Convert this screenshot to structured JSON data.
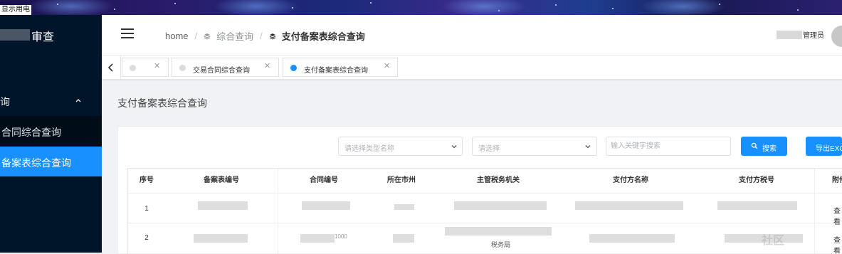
{
  "banner": {
    "label": "显示用电"
  },
  "sidebar": {
    "app_title": "审查",
    "menu_group": "询",
    "items": [
      {
        "label": "合同综合查询",
        "active": false
      },
      {
        "label": "备案表综合查询",
        "active": true
      }
    ],
    "colors": {
      "bg": "#001529",
      "active": "#1890ff"
    }
  },
  "header": {
    "menu_icon": "hamburger-icon",
    "breadcrumb": [
      {
        "label": "home"
      },
      {
        "label": "综合查询",
        "icon": "layers-icon"
      },
      {
        "label": "支付备案表综合查询",
        "icon": "layers-icon"
      }
    ],
    "user_role": "管理员"
  },
  "tabs": [
    {
      "label": "",
      "active": false
    },
    {
      "label": "交易合同综合查询",
      "active": false
    },
    {
      "label": "支付备案表综合查询",
      "active": true
    }
  ],
  "main": {
    "page_title": "支付备案表综合查询",
    "filters": {
      "type_select_placeholder": "请选择类型名称",
      "select2_placeholder": "请选择",
      "keyword_placeholder": "输入关键字搜索"
    },
    "buttons": {
      "search": "搜索",
      "export": "导出EXC"
    },
    "table": {
      "columns": [
        "序号",
        "备案表编号",
        "合同编号",
        "所在市州",
        "主管税务机关",
        "支付方名称",
        "支付方税号",
        "附件"
      ],
      "rows": [
        {
          "index": "1",
          "contract_tail": "",
          "tax_office_tail": "",
          "action": "查看"
        },
        {
          "index": "2",
          "contract_tail": "1000",
          "tax_office_tail": "税务局",
          "action": "查看"
        }
      ]
    }
  },
  "watermark": "社区"
}
